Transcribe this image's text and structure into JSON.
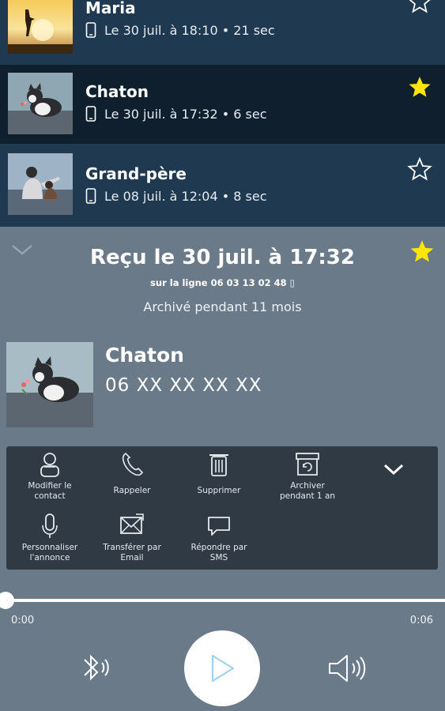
{
  "calls": [
    {
      "name": "Maria",
      "meta": "Le 30 juil. à 18:10 • 21 sec",
      "starred": false
    },
    {
      "name": "Chaton",
      "meta": "Le 30 juil. à 17:32 • 6 sec",
      "starred": true
    },
    {
      "name": "Grand-père",
      "meta": "Le 08 juil. à 12:04 • 8 sec",
      "starred": false
    }
  ],
  "detail": {
    "title": "Reçu le 30 juil. à 17:32",
    "line": "sur la ligne 06 03 13 02 48 ▯",
    "archived": "Archivé pendant 11 mois",
    "contact_name": "Chaton",
    "contact_number": "06 XX XX XX XX",
    "starred": true
  },
  "actions": {
    "edit": "Modifier le\ncontact",
    "callback": "Rappeler",
    "delete": "Supprimer",
    "archive": "Archiver\npendant 1 an",
    "customize": "Personnaliser\nl'annonce",
    "forward": "Transférer par\nEmail",
    "reply": "Répondre par\nSMS"
  },
  "player": {
    "time_start": "0:00",
    "time_end": "0:06",
    "progress": 0
  },
  "colors": {
    "list_bg": "#1f3950",
    "selected_bg": "#0f1f2e",
    "detail_bg": "#6b7a89",
    "actions_bg": "#2f3a44",
    "star_active": "#ffe600"
  }
}
